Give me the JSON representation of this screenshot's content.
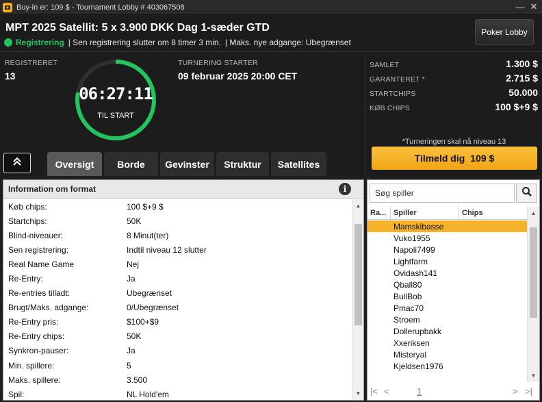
{
  "titlebar": {
    "title": "Buy-in er: 109 $ - Tournament Lobby # 403067508",
    "minimize": "—",
    "close": "✕"
  },
  "header": {
    "title": "MPT 2025 Satellit: 5 x 3.900 DKK Dag 1-sæder GTD",
    "status": "Registrering",
    "late_reg": "| Sen registrering slutter om 8 timer  3 min.",
    "max_entries": "| Maks. nye adgange: Ubegrænset",
    "lobby_button": "Poker Lobby"
  },
  "registered": {
    "label": "REGISTRERET",
    "value": "13"
  },
  "timer": {
    "time": "06:27:11",
    "caption": "TIL START",
    "progress": 0.78
  },
  "start": {
    "label": "TURNERING STARTER",
    "value": "09 februar 2025  20:00 CET"
  },
  "stats": [
    {
      "label": "SAMLET",
      "value": "1.300 $"
    },
    {
      "label": "GARANTERET *",
      "value": "2.715 $"
    },
    {
      "label": "STARTCHIPS",
      "value": "50.000"
    },
    {
      "label": "KØB CHIPS",
      "value": "100 $+9 $"
    }
  ],
  "note": "*Turneringen skal nå niveau 13",
  "signup": {
    "label": "Tilmeld dig",
    "amount": "109 $"
  },
  "tabs": [
    "Oversigt",
    "Borde",
    "Gevinster",
    "Struktur",
    "Satellites"
  ],
  "active_tab": "Oversigt",
  "format": {
    "title": "Information om format",
    "rows": [
      {
        "k": "Køb chips:",
        "v": "100 $+9 $"
      },
      {
        "k": "Startchips:",
        "v": "50K"
      },
      {
        "k": "Blind-niveauer:",
        "v": "8 Minut(ter)"
      },
      {
        "k": "Sen registrering:",
        "v": "Indtil niveau 12 slutter"
      },
      {
        "k": "Real Name Game",
        "v": "Nej"
      },
      {
        "k": "Re-Entry:",
        "v": "Ja"
      },
      {
        "k": "Re-entries tilladt:",
        "v": "Ubegrænset"
      },
      {
        "k": "Brugt/Maks. adgange:",
        "v": "0/Ubegrænset"
      },
      {
        "k": "Re-Entry pris:",
        "v": "$100+$9"
      },
      {
        "k": "Re-Entry chips:",
        "v": "50K"
      },
      {
        "k": "Synkron-pauser:",
        "v": "Ja"
      },
      {
        "k": "Min. spillere:",
        "v": "5"
      },
      {
        "k": "Maks. spillere:",
        "v": "3.500"
      },
      {
        "k": "Spil:",
        "v": "NL Hold'em"
      }
    ]
  },
  "players": {
    "search_placeholder": "Søg spiller",
    "columns": [
      "Ra...",
      "Spiller",
      "Chips"
    ],
    "list": [
      "Mamskibasse",
      "Vuko1955",
      "Napoli7499",
      "Lightfarm",
      "Ovidash141",
      "Qball80",
      "BullBob",
      "Pmac70",
      "Stroem",
      "Dollerupbakk",
      "Xxeriksen",
      "Misteryal",
      "Kjeldsen1976"
    ],
    "selected_index": 0,
    "page": "1"
  },
  "colors": {
    "accent": "#f5b22a",
    "status_green": "#22c55e"
  }
}
